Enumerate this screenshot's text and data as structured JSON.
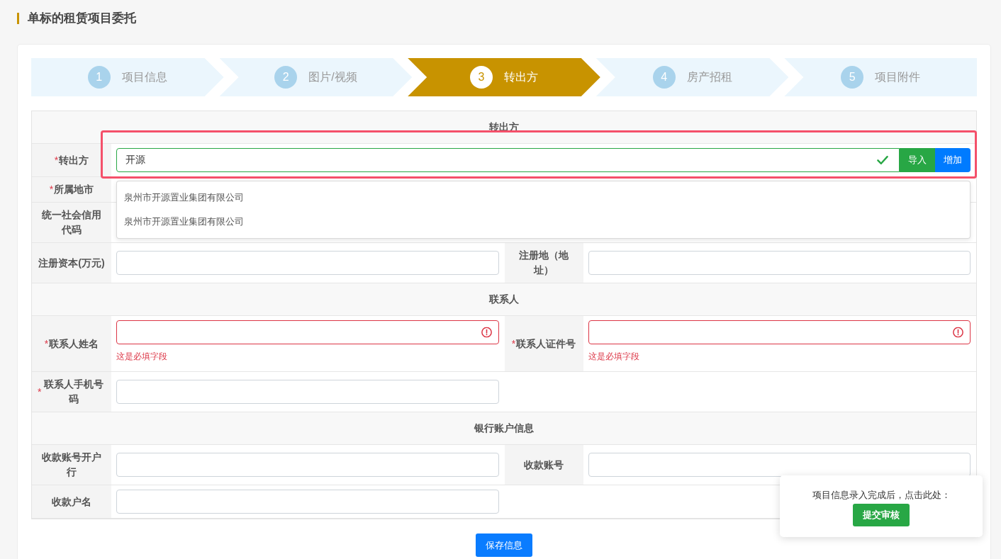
{
  "page_title": "单标的租赁项目委托",
  "steps": [
    {
      "number": "1",
      "label": "项目信息",
      "selected": false
    },
    {
      "number": "2",
      "label": "图片/视频",
      "selected": false
    },
    {
      "number": "3",
      "label": "转出方",
      "selected": true
    },
    {
      "number": "4",
      "label": "房产招租",
      "selected": false
    },
    {
      "number": "5",
      "label": "项目附件",
      "selected": false
    }
  ],
  "sections": [
    {
      "title": "转出方",
      "rows": [
        {
          "kind": "lookup",
          "label": {
            "mark": "*",
            "text": "转出方"
          },
          "field": {
            "value": "开源",
            "valid": true,
            "invalid": false
          },
          "buttons": [
            {
              "label": "导入",
              "kind": "success"
            },
            {
              "label": "增加",
              "kind": "primary"
            }
          ],
          "suggestions": [
            "泉州市开源置业集团有限公司",
            "泉州市开源置业集团有限公司"
          ]
        },
        {
          "kind": "covered",
          "label": {
            "mark": "*",
            "text": "所属地市"
          }
        },
        {
          "kind": "covered",
          "label": {
            "text": "统一社会信用代码"
          }
        },
        {
          "kind": "fields",
          "cells": [
            {
              "label": {
                "text": "注册资本(万元)"
              },
              "field": {
                "valid": false,
                "invalid": false
              }
            },
            {
              "label": {
                "text": "注册地（地址）"
              },
              "field": {
                "valid": false,
                "invalid": false
              }
            }
          ]
        }
      ]
    },
    {
      "title": "联系人",
      "rows": [
        {
          "kind": "fields",
          "cells": [
            {
              "label": {
                "mark": "*",
                "text": "联系人姓名"
              },
              "field": {
                "valid": false,
                "invalid": true,
                "error": "这是必填字段"
              }
            },
            {
              "label": {
                "mark": "*",
                "text": "联系人证件号"
              },
              "field": {
                "valid": false,
                "invalid": true,
                "error": "这是必填字段"
              }
            }
          ]
        },
        {
          "kind": "fields",
          "cells": [
            {
              "label": {
                "mark": "*",
                "text": "联系人手机号码"
              },
              "field": {
                "valid": false,
                "invalid": false
              }
            }
          ]
        }
      ]
    },
    {
      "title": "银行账户信息",
      "rows": [
        {
          "kind": "fields",
          "cells": [
            {
              "label": {
                "text": "收款账号开户行"
              },
              "field": {
                "valid": false,
                "invalid": false
              }
            },
            {
              "label": {
                "text": "收款账号"
              },
              "field": {
                "valid": false,
                "invalid": false
              }
            }
          ]
        },
        {
          "kind": "fields",
          "cells": [
            {
              "label": {
                "text": "收款户名"
              },
              "field": {
                "valid": false,
                "invalid": false
              }
            }
          ]
        }
      ]
    }
  ],
  "save_button": "保存信息",
  "popover": {
    "text": "项目信息录入完成后，点击此处：",
    "button": "提交审核"
  }
}
